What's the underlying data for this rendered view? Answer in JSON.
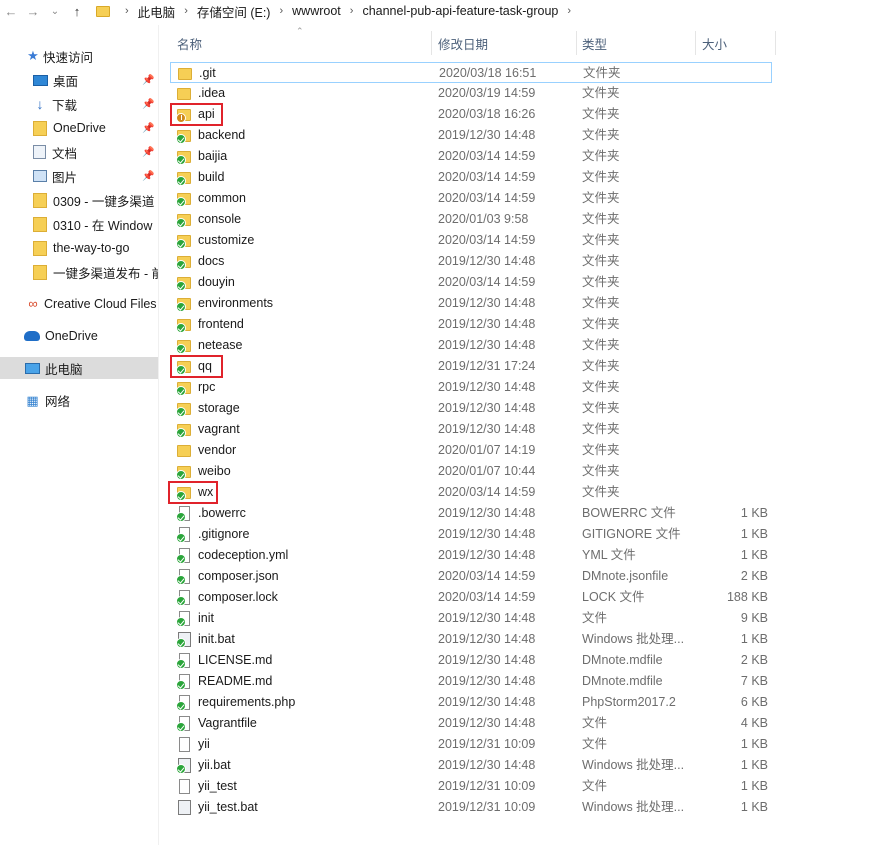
{
  "address": {
    "back_icon": "back-arrow-icon",
    "forward_icon": "forward-arrow-icon",
    "recent_icon": "chevron-down-icon",
    "up_icon": "up-arrow-icon",
    "crumbs": [
      "此电脑",
      "存储空间 (E:)",
      "wwwroot",
      "channel-pub-api-feature-task-group"
    ]
  },
  "nav": {
    "quick_access": "快速访问",
    "items": [
      {
        "label": "桌面",
        "icon": "desktop-icon",
        "pinned": true
      },
      {
        "label": "下载",
        "icon": "download-icon",
        "pinned": true
      },
      {
        "label": "OneDrive",
        "icon": "folder-icon",
        "pinned": true
      },
      {
        "label": "文档",
        "icon": "documents-icon",
        "pinned": true
      },
      {
        "label": "图片",
        "icon": "pictures-icon",
        "pinned": true
      },
      {
        "label": "0309 - 一键多渠道",
        "icon": "folder-icon",
        "pinned": false
      },
      {
        "label": "0310 - 在 Window",
        "icon": "folder-icon",
        "pinned": false
      },
      {
        "label": "the-way-to-go",
        "icon": "folder-icon",
        "pinned": false
      },
      {
        "label": "一键多渠道发布 - 前",
        "icon": "folder-icon",
        "pinned": false
      }
    ],
    "creative_cloud": "Creative Cloud Files",
    "onedrive": "OneDrive",
    "this_pc": "此电脑",
    "network": "网络"
  },
  "columns": {
    "name": "名称",
    "date": "修改日期",
    "type": "类型",
    "size": "大小"
  },
  "files": [
    {
      "name": ".git",
      "date": "2020/03/18 16:51",
      "type": "文件夹",
      "size": "",
      "kind": "folder",
      "badge": "none"
    },
    {
      "name": ".idea",
      "date": "2020/03/19 14:59",
      "type": "文件夹",
      "size": "",
      "kind": "folder",
      "badge": "none"
    },
    {
      "name": "api",
      "date": "2020/03/18 16:26",
      "type": "文件夹",
      "size": "",
      "kind": "folder",
      "badge": "warn"
    },
    {
      "name": "backend",
      "date": "2019/12/30 14:48",
      "type": "文件夹",
      "size": "",
      "kind": "folder",
      "badge": "ok"
    },
    {
      "name": "baijia",
      "date": "2020/03/14 14:59",
      "type": "文件夹",
      "size": "",
      "kind": "folder",
      "badge": "ok"
    },
    {
      "name": "build",
      "date": "2020/03/14 14:59",
      "type": "文件夹",
      "size": "",
      "kind": "folder",
      "badge": "ok"
    },
    {
      "name": "common",
      "date": "2020/03/14 14:59",
      "type": "文件夹",
      "size": "",
      "kind": "folder",
      "badge": "ok"
    },
    {
      "name": "console",
      "date": "2020/01/03 9:58",
      "type": "文件夹",
      "size": "",
      "kind": "folder",
      "badge": "ok"
    },
    {
      "name": "customize",
      "date": "2020/03/14 14:59",
      "type": "文件夹",
      "size": "",
      "kind": "folder",
      "badge": "ok"
    },
    {
      "name": "docs",
      "date": "2019/12/30 14:48",
      "type": "文件夹",
      "size": "",
      "kind": "folder",
      "badge": "ok"
    },
    {
      "name": "douyin",
      "date": "2020/03/14 14:59",
      "type": "文件夹",
      "size": "",
      "kind": "folder",
      "badge": "ok"
    },
    {
      "name": "environments",
      "date": "2019/12/30 14:48",
      "type": "文件夹",
      "size": "",
      "kind": "folder",
      "badge": "ok"
    },
    {
      "name": "frontend",
      "date": "2019/12/30 14:48",
      "type": "文件夹",
      "size": "",
      "kind": "folder",
      "badge": "ok"
    },
    {
      "name": "netease",
      "date": "2019/12/30 14:48",
      "type": "文件夹",
      "size": "",
      "kind": "folder",
      "badge": "ok"
    },
    {
      "name": "qq",
      "date": "2019/12/31 17:24",
      "type": "文件夹",
      "size": "",
      "kind": "folder",
      "badge": "ok"
    },
    {
      "name": "rpc",
      "date": "2019/12/30 14:48",
      "type": "文件夹",
      "size": "",
      "kind": "folder",
      "badge": "ok"
    },
    {
      "name": "storage",
      "date": "2019/12/30 14:48",
      "type": "文件夹",
      "size": "",
      "kind": "folder",
      "badge": "ok"
    },
    {
      "name": "vagrant",
      "date": "2019/12/30 14:48",
      "type": "文件夹",
      "size": "",
      "kind": "folder",
      "badge": "ok"
    },
    {
      "name": "vendor",
      "date": "2020/01/07 14:19",
      "type": "文件夹",
      "size": "",
      "kind": "folder",
      "badge": "none"
    },
    {
      "name": "weibo",
      "date": "2020/01/07 10:44",
      "type": "文件夹",
      "size": "",
      "kind": "folder",
      "badge": "ok"
    },
    {
      "name": "wx",
      "date": "2020/03/14 14:59",
      "type": "文件夹",
      "size": "",
      "kind": "folder",
      "badge": "ok"
    },
    {
      "name": ".bowerrc",
      "date": "2019/12/30 14:48",
      "type": "BOWERRC 文件",
      "size": "1 KB",
      "kind": "file",
      "badge": "ok"
    },
    {
      "name": ".gitignore",
      "date": "2019/12/30 14:48",
      "type": "GITIGNORE 文件",
      "size": "1 KB",
      "kind": "file",
      "badge": "ok"
    },
    {
      "name": "codeception.yml",
      "date": "2019/12/30 14:48",
      "type": "YML 文件",
      "size": "1 KB",
      "kind": "file",
      "badge": "ok"
    },
    {
      "name": "composer.json",
      "date": "2020/03/14 14:59",
      "type": "DMnote.jsonfile",
      "size": "2 KB",
      "kind": "file",
      "badge": "ok"
    },
    {
      "name": "composer.lock",
      "date": "2020/03/14 14:59",
      "type": "LOCK 文件",
      "size": "188 KB",
      "kind": "file",
      "badge": "ok"
    },
    {
      "name": "init",
      "date": "2019/12/30 14:48",
      "type": "文件",
      "size": "9 KB",
      "kind": "file",
      "badge": "ok"
    },
    {
      "name": "init.bat",
      "date": "2019/12/30 14:48",
      "type": "Windows 批处理...",
      "size": "1 KB",
      "kind": "bat",
      "badge": "ok"
    },
    {
      "name": "LICENSE.md",
      "date": "2019/12/30 14:48",
      "type": "DMnote.mdfile",
      "size": "2 KB",
      "kind": "file",
      "badge": "ok"
    },
    {
      "name": "README.md",
      "date": "2019/12/30 14:48",
      "type": "DMnote.mdfile",
      "size": "7 KB",
      "kind": "file",
      "badge": "ok"
    },
    {
      "name": "requirements.php",
      "date": "2019/12/30 14:48",
      "type": "PhpStorm2017.2",
      "size": "6 KB",
      "kind": "file",
      "badge": "ok"
    },
    {
      "name": "Vagrantfile",
      "date": "2019/12/30 14:48",
      "type": "文件",
      "size": "4 KB",
      "kind": "file",
      "badge": "ok"
    },
    {
      "name": "yii",
      "date": "2019/12/31 10:09",
      "type": "文件",
      "size": "1 KB",
      "kind": "file",
      "badge": "none"
    },
    {
      "name": "yii.bat",
      "date": "2019/12/30 14:48",
      "type": "Windows 批处理...",
      "size": "1 KB",
      "kind": "bat",
      "badge": "ok"
    },
    {
      "name": "yii_test",
      "date": "2019/12/31 10:09",
      "type": "文件",
      "size": "1 KB",
      "kind": "file",
      "badge": "none"
    },
    {
      "name": "yii_test.bat",
      "date": "2019/12/31 10:09",
      "type": "Windows 批处理...",
      "size": "1 KB",
      "kind": "bat",
      "badge": "none"
    }
  ],
  "highlighted": [
    "api",
    "qq",
    "wx"
  ],
  "colors": {
    "folder": "#f6cf55",
    "sync_ok": "#2aa53a",
    "sync_pending": "#d08a1a",
    "highlight": "#e0232b",
    "selection": "#99d1ff"
  }
}
